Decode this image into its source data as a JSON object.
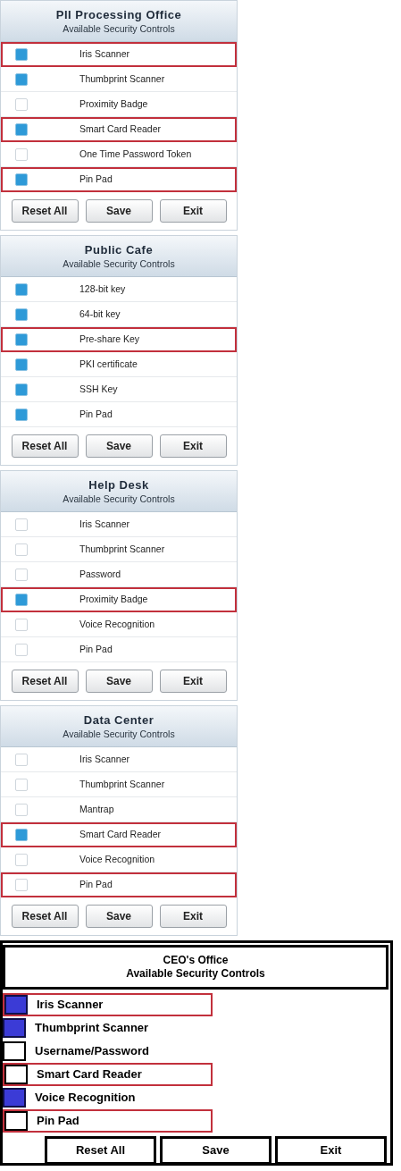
{
  "panels": [
    {
      "kind": "soft",
      "title": "PII Processing Office",
      "subtitle": "Available Security Controls",
      "items": [
        {
          "label": "Iris Scanner",
          "checked": true,
          "highlighted": true
        },
        {
          "label": "Thumbprint Scanner",
          "checked": true,
          "highlighted": false
        },
        {
          "label": "Proximity Badge",
          "checked": false,
          "highlighted": false
        },
        {
          "label": "Smart Card Reader",
          "checked": true,
          "highlighted": true
        },
        {
          "label": "One Time Password Token",
          "checked": false,
          "highlighted": false
        },
        {
          "label": "Pin Pad",
          "checked": true,
          "highlighted": true
        }
      ],
      "buttons": [
        "Reset All",
        "Save",
        "Exit"
      ]
    },
    {
      "kind": "soft",
      "title": "Public Cafe",
      "subtitle": "Available Security Controls",
      "items": [
        {
          "label": "128-bit key",
          "checked": true,
          "highlighted": false
        },
        {
          "label": "64-bit key",
          "checked": true,
          "highlighted": false
        },
        {
          "label": "Pre-share Key",
          "checked": true,
          "highlighted": true
        },
        {
          "label": "PKI certificate",
          "checked": true,
          "highlighted": false
        },
        {
          "label": "SSH Key",
          "checked": true,
          "highlighted": false
        },
        {
          "label": "Pin Pad",
          "checked": true,
          "highlighted": false
        }
      ],
      "buttons": [
        "Reset All",
        "Save",
        "Exit"
      ]
    },
    {
      "kind": "soft",
      "title": "Help Desk",
      "subtitle": "Available Security Controls",
      "items": [
        {
          "label": "Iris Scanner",
          "checked": false,
          "highlighted": false
        },
        {
          "label": "Thumbprint Scanner",
          "checked": false,
          "highlighted": false
        },
        {
          "label": "Password",
          "checked": false,
          "highlighted": false
        },
        {
          "label": "Proximity Badge",
          "checked": true,
          "highlighted": true
        },
        {
          "label": "Voice Recognition",
          "checked": false,
          "highlighted": false
        },
        {
          "label": "Pin Pad",
          "checked": false,
          "highlighted": false
        }
      ],
      "buttons": [
        "Reset All",
        "Save",
        "Exit"
      ]
    },
    {
      "kind": "soft",
      "title": "Data Center",
      "subtitle": "Available Security Controls",
      "items": [
        {
          "label": "Iris Scanner",
          "checked": false,
          "highlighted": false
        },
        {
          "label": "Thumbprint Scanner",
          "checked": false,
          "highlighted": false
        },
        {
          "label": "Mantrap",
          "checked": false,
          "highlighted": false
        },
        {
          "label": "Smart Card Reader",
          "checked": true,
          "highlighted": true
        },
        {
          "label": "Voice Recognition",
          "checked": false,
          "highlighted": false
        },
        {
          "label": "Pin Pad",
          "checked": false,
          "highlighted": true
        }
      ],
      "buttons": [
        "Reset All",
        "Save",
        "Exit"
      ]
    },
    {
      "kind": "bold",
      "title": "CEO's Office",
      "subtitle": "Available Security Controls",
      "items": [
        {
          "label": "Iris Scanner",
          "checked": true,
          "highlighted": true
        },
        {
          "label": "Thumbprint Scanner",
          "checked": true,
          "highlighted": false
        },
        {
          "label": "Username/Password",
          "checked": false,
          "highlighted": false
        },
        {
          "label": "Smart Card Reader",
          "checked": false,
          "highlighted": true
        },
        {
          "label": "Voice Recognition",
          "checked": true,
          "highlighted": false
        },
        {
          "label": "Pin Pad",
          "checked": false,
          "highlighted": true
        }
      ],
      "buttons": [
        "Reset All",
        "Save",
        "Exit"
      ]
    }
  ]
}
